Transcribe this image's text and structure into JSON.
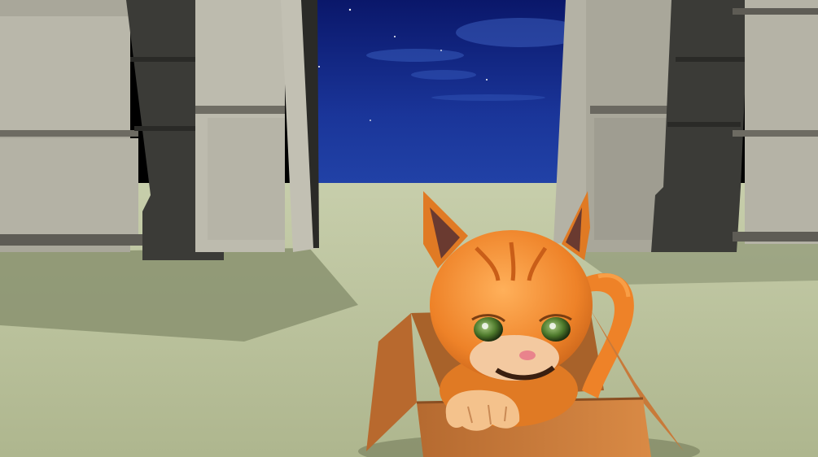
{
  "scene": {
    "kind": "3d-game-viewport",
    "colors": {
      "sky_top": "#0a1a6e",
      "sky_bottom": "#1f3fa8",
      "ground": "#b9c19a",
      "ground_shadow": "#8f9776",
      "wall_face": "#b8b6a8",
      "pillar": "#3a3a36",
      "pillar_dark": "#2a2a27",
      "cat_orange": "#f08a2a",
      "cat_light": "#ffb15a",
      "cat_eye": "#5f8a3a",
      "box": "#c87a3a",
      "box_dark": "#9a5a28"
    },
    "objects": [
      {
        "name": "night-sky-gateway"
      },
      {
        "name": "stone-wall-left"
      },
      {
        "name": "stone-wall-right"
      },
      {
        "name": "orange-kitten"
      },
      {
        "name": "cardboard-box"
      }
    ]
  }
}
